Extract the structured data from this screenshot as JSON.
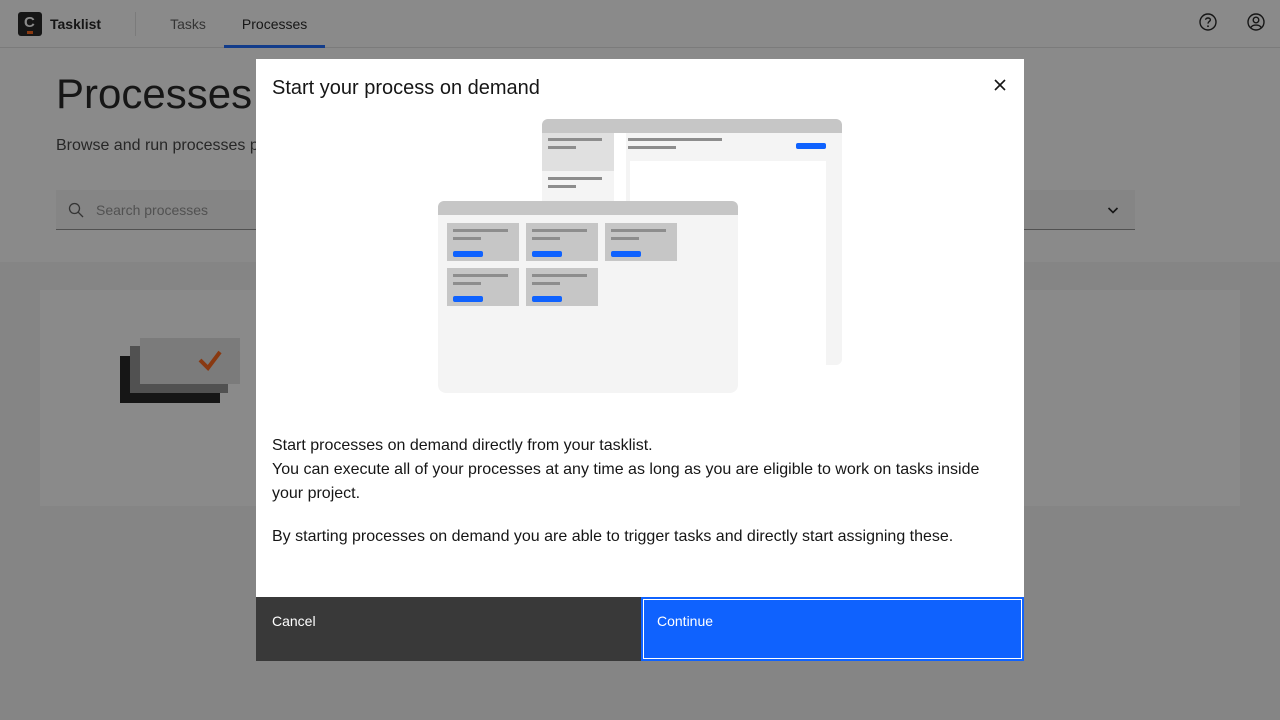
{
  "header": {
    "brand": "Tasklist",
    "logo_letter": "C",
    "nav": [
      {
        "label": "Tasks",
        "active": false
      },
      {
        "label": "Processes",
        "active": true
      }
    ],
    "icons": [
      "help-icon",
      "user-profile-icon"
    ]
  },
  "page": {
    "title": "Processes",
    "subtitle": "Browse and run processes p",
    "search_placeholder": "Search processes"
  },
  "modal": {
    "title": "Start your process on demand",
    "body_line1": "Start processes on demand directly from your tasklist.",
    "body_line2": "You can execute all of your processes at any time as long as you are eligible to work on tasks inside your project.",
    "body_line3": "By starting processes on demand you are able to trigger tasks and directly start assigning these.",
    "cancel_label": "Cancel",
    "continue_label": "Continue"
  },
  "colors": {
    "primary": "#0f62fe",
    "dark_button": "#393939",
    "accent_orange": "#fc5d0d"
  }
}
